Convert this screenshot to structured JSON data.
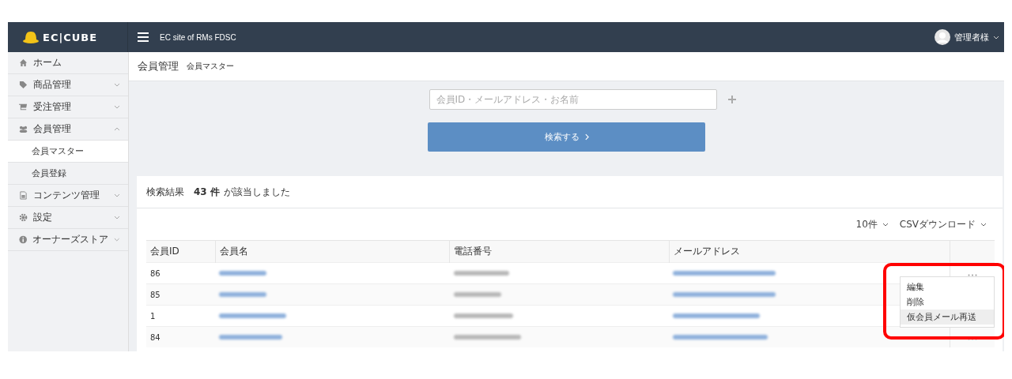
{
  "header": {
    "logo": "EC|CUBE",
    "site_name": "EC site of RMs FDSC",
    "user": "管理者様"
  },
  "sidebar": {
    "items": [
      {
        "label": "ホーム",
        "expandable": false
      },
      {
        "label": "商品管理",
        "expandable": true,
        "expanded": false
      },
      {
        "label": "受注管理",
        "expandable": true,
        "expanded": false
      },
      {
        "label": "会員管理",
        "expandable": true,
        "expanded": true,
        "children": [
          {
            "label": "会員マスター",
            "selected": true
          },
          {
            "label": "会員登録",
            "selected": false
          }
        ]
      },
      {
        "label": "コンテンツ管理",
        "expandable": true,
        "expanded": false
      },
      {
        "label": "設定",
        "expandable": true,
        "expanded": false
      },
      {
        "label": "オーナーズストア",
        "expandable": true,
        "expanded": false
      }
    ]
  },
  "page_title": {
    "title": "会員管理",
    "subtitle": "会員マスター"
  },
  "search": {
    "placeholder": "会員ID・メールアドレス・お名前",
    "button": "検索する"
  },
  "results": {
    "label": "検索結果",
    "count": "43 件",
    "suffix": "が該当しました",
    "per_page": "10件",
    "csv": "CSVダウンロード"
  },
  "table": {
    "columns": [
      "会員ID",
      "会員名",
      "電話番号",
      "メールアドレス"
    ],
    "rows": [
      {
        "id": "86"
      },
      {
        "id": "85"
      },
      {
        "id": "1"
      },
      {
        "id": "84"
      }
    ]
  },
  "action_menu": {
    "items": [
      {
        "label": "編集",
        "hovered": false
      },
      {
        "label": "削除",
        "hovered": false
      },
      {
        "label": "仮会員メール再送",
        "hovered": true
      }
    ]
  }
}
